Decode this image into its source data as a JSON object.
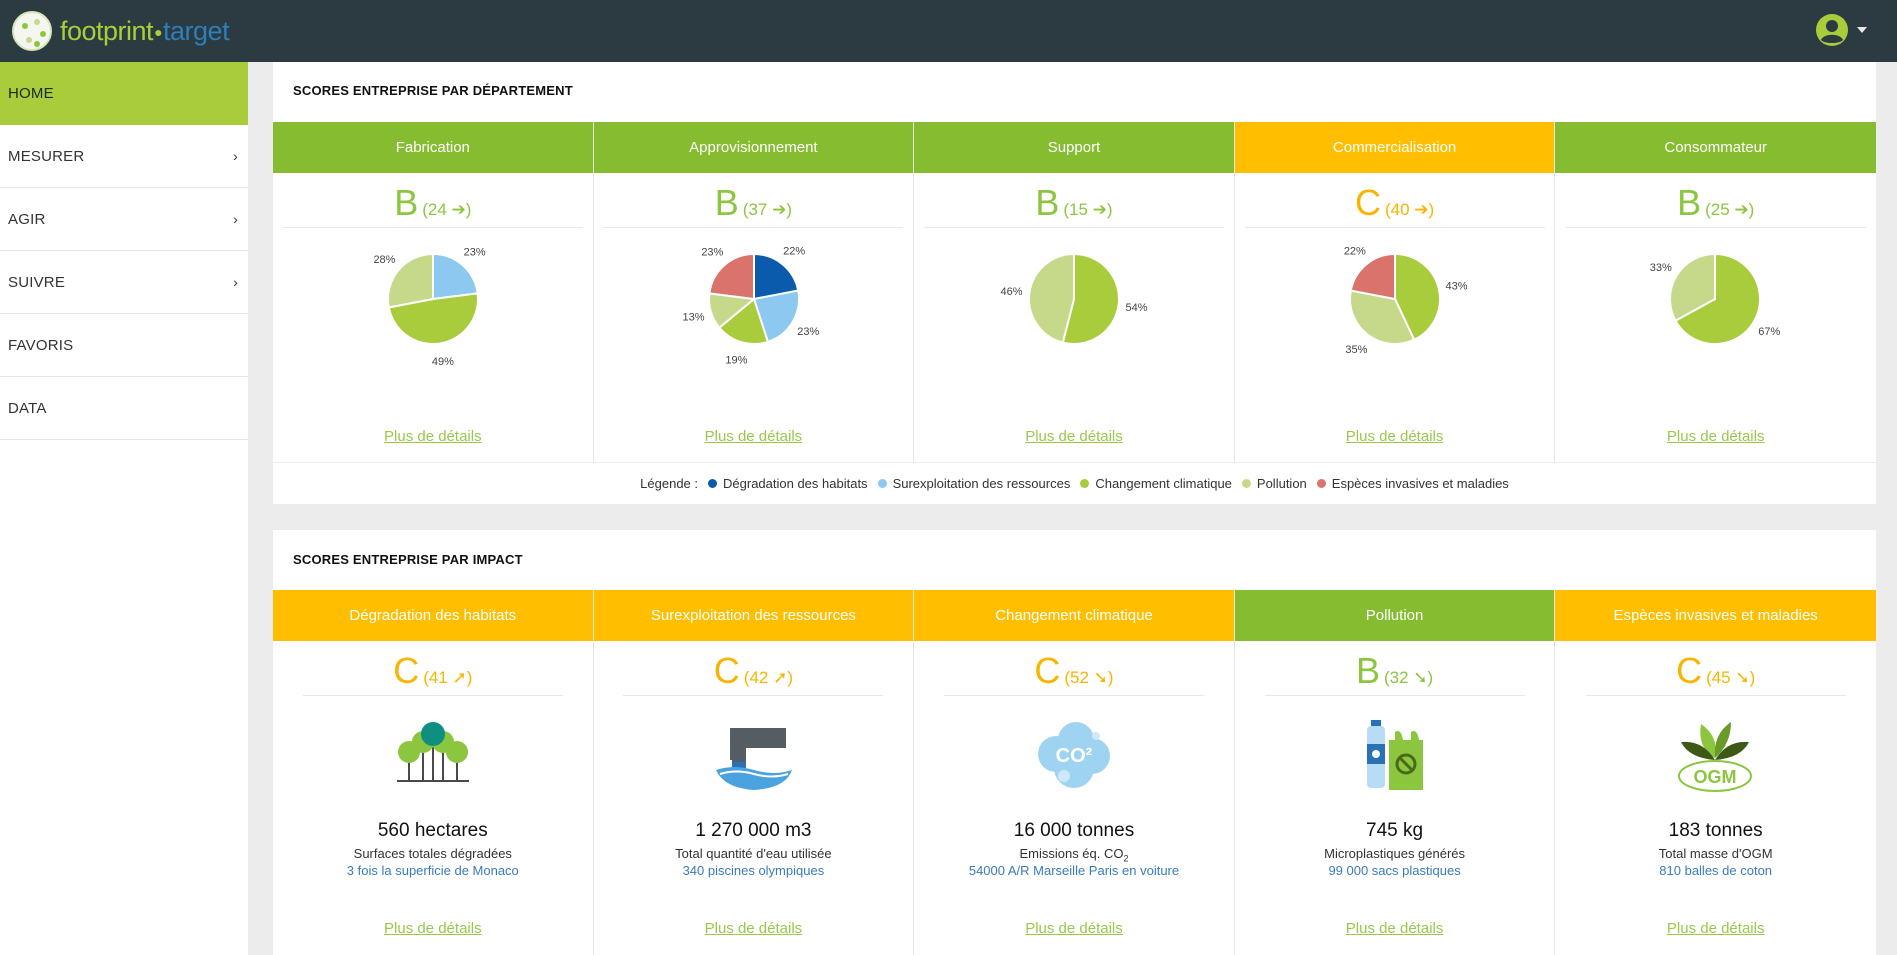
{
  "header": {
    "logo_text_a": "footprint",
    "logo_text_b": "target"
  },
  "sidebar": {
    "items": [
      {
        "label": "HOME",
        "active": true,
        "has_submenu": false
      },
      {
        "label": "MESURER",
        "active": false,
        "has_submenu": true
      },
      {
        "label": "AGIR",
        "active": false,
        "has_submenu": true
      },
      {
        "label": "SUIVRE",
        "active": false,
        "has_submenu": true
      },
      {
        "label": "FAVORIS",
        "active": false,
        "has_submenu": false
      },
      {
        "label": "DATA",
        "active": false,
        "has_submenu": false
      }
    ]
  },
  "departments": {
    "title": "SCORES ENTREPRISE PAR DÉPARTEMENT",
    "cards": [
      {
        "name": "Fabrication",
        "header_color": "#86bc30",
        "grade": "B",
        "score": "(24 ➔)",
        "grade_color": "#8cc63f",
        "details": "Plus de détails",
        "pie": [
          {
            "cat": "Surexploitation des ressources",
            "value": 23,
            "label": "23%"
          },
          {
            "cat": "Changement climatique",
            "value": 49,
            "label": "49%"
          },
          {
            "cat": "Pollution",
            "value": 28,
            "label": "28%"
          }
        ]
      },
      {
        "name": "Approvisionnement",
        "header_color": "#86bc30",
        "grade": "B",
        "score": "(37 ➔)",
        "grade_color": "#8cc63f",
        "details": "Plus de détails",
        "pie": [
          {
            "cat": "Dégradation des habitats",
            "value": 22,
            "label": "22%"
          },
          {
            "cat": "Surexploitation des ressources",
            "value": 23,
            "label": "23%"
          },
          {
            "cat": "Changement climatique",
            "value": 19,
            "label": "19%"
          },
          {
            "cat": "Pollution",
            "value": 13,
            "label": "13%"
          },
          {
            "cat": "Espèces invasives et maladies",
            "value": 23,
            "label": "23%"
          }
        ]
      },
      {
        "name": "Support",
        "header_color": "#86bc30",
        "grade": "B",
        "score": "(15 ➔)",
        "grade_color": "#8cc63f",
        "details": "Plus de détails",
        "pie": [
          {
            "cat": "Changement climatique",
            "value": 54,
            "label": "54%"
          },
          {
            "cat": "Pollution",
            "value": 46,
            "label": "46%"
          }
        ]
      },
      {
        "name": "Commercialisation",
        "header_color": "#ffbf00",
        "grade": "C",
        "score": "(40 ➔)",
        "grade_color": "#f7b500",
        "details": "Plus de détails",
        "pie": [
          {
            "cat": "Changement climatique",
            "value": 43,
            "label": "43%"
          },
          {
            "cat": "Pollution",
            "value": 35,
            "label": "35%"
          },
          {
            "cat": "Espèces invasives et maladies",
            "value": 22,
            "label": "22%"
          }
        ]
      },
      {
        "name": "Consommateur",
        "header_color": "#86bc30",
        "grade": "B",
        "score": "(25 ➔)",
        "grade_color": "#8cc63f",
        "details": "Plus de détails",
        "pie": [
          {
            "cat": "Changement climatique",
            "value": 67,
            "label": "67%"
          },
          {
            "cat": "Pollution",
            "value": 33,
            "label": "33%"
          }
        ]
      }
    ],
    "legend_label": "Légende :",
    "legend": [
      {
        "name": "Dégradation des habitats",
        "color": "#0a5bab"
      },
      {
        "name": "Surexploitation des ressources",
        "color": "#8cc8f0"
      },
      {
        "name": "Changement climatique",
        "color": "#a8cc3b"
      },
      {
        "name": "Pollution",
        "color": "#c6d98b"
      },
      {
        "name": "Espèces invasives et maladies",
        "color": "#d9736b"
      }
    ]
  },
  "chart_data": [
    {
      "type": "pie",
      "title": "Fabrication",
      "categories": [
        "Surexploitation des ressources",
        "Changement climatique",
        "Pollution"
      ],
      "values": [
        23,
        49,
        28
      ]
    },
    {
      "type": "pie",
      "title": "Approvisionnement",
      "categories": [
        "Dégradation des habitats",
        "Surexploitation des ressources",
        "Changement climatique",
        "Pollution",
        "Espèces invasives et maladies"
      ],
      "values": [
        22,
        23,
        19,
        13,
        23
      ]
    },
    {
      "type": "pie",
      "title": "Support",
      "categories": [
        "Changement climatique",
        "Pollution"
      ],
      "values": [
        54,
        46
      ]
    },
    {
      "type": "pie",
      "title": "Commercialisation",
      "categories": [
        "Changement climatique",
        "Pollution",
        "Espèces invasives et maladies"
      ],
      "values": [
        43,
        35,
        22
      ]
    },
    {
      "type": "pie",
      "title": "Consommateur",
      "categories": [
        "Changement climatique",
        "Pollution"
      ],
      "values": [
        67,
        33
      ]
    }
  ],
  "impacts": {
    "title": "SCORES ENTREPRISE PAR IMPACT",
    "cards": [
      {
        "name": "Dégradation des habitats",
        "header_color": "#ffbf00",
        "grade": "C",
        "score": "(41 ➚)",
        "grade_color": "#f7b500",
        "icon": "trees-icon",
        "value": "560 hectares",
        "label": "Surfaces totales dégradées",
        "equiv": "3 fois la superficie de Monaco",
        "details": "Plus de détails"
      },
      {
        "name": "Surexploitation des ressources",
        "header_color": "#ffbf00",
        "grade": "C",
        "score": "(42 ➚)",
        "grade_color": "#f7b500",
        "icon": "water-pipe-icon",
        "value": "1 270 000 m3",
        "label": "Total quantité d'eau utilisée",
        "equiv": "340 piscines olympiques",
        "details": "Plus de détails"
      },
      {
        "name": "Changement climatique",
        "header_color": "#ffbf00",
        "grade": "C",
        "score": "(52 ➘)",
        "grade_color": "#f7b500",
        "icon": "co2-cloud-icon",
        "value": "16 000 tonnes",
        "label": "Emissions éq. CO",
        "label_sub": "2",
        "equiv": "54000 A/R Marseille Paris en voiture",
        "details": "Plus de détails"
      },
      {
        "name": "Pollution",
        "header_color": "#86bc30",
        "grade": "B",
        "score": "(32 ➘)",
        "grade_color": "#8cc63f",
        "icon": "plastic-bottle-bag-icon",
        "value": "745 kg",
        "label": "Microplastiques générés",
        "equiv": "99 000 sacs plastiques",
        "details": "Plus de détails"
      },
      {
        "name": "Espèces invasives et maladies",
        "header_color": "#ffbf00",
        "grade": "C",
        "score": "(45 ➘)",
        "grade_color": "#f7b500",
        "icon": "ogm-leaf-icon",
        "icon_text": "OGM",
        "icon_sup": "2",
        "value": "183 tonnes",
        "label": "Total masse d'OGM",
        "equiv": "810 balles de coton",
        "details": "Plus de détails"
      }
    ]
  },
  "co2_icon_text": "CO²"
}
